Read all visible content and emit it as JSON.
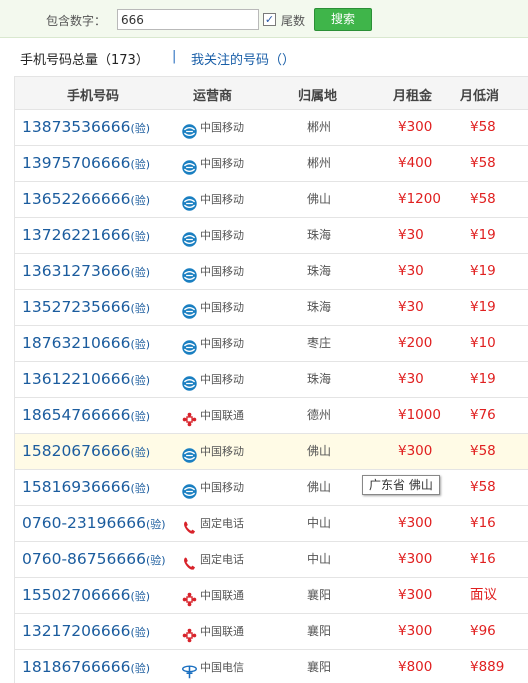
{
  "search": {
    "label": "包含数字：",
    "value": "666",
    "tail_checked": "✓",
    "tail_label": "尾数",
    "button": "搜索"
  },
  "tabs": {
    "total": "手机号码总量（173）",
    "separator": "|",
    "favorites": "我关注的号码（）"
  },
  "table": {
    "headers": {
      "number": "手机号码",
      "operator": "运营商",
      "location": "归属地",
      "rent": "月租金",
      "minimum": "月低消"
    },
    "rows": [
      {
        "number": "13873536666",
        "verify": "(验)",
        "operator": "中国移动",
        "operator_icon": "china-mobile-icon",
        "location": "郴州",
        "rent": "¥300",
        "minimum": "¥58"
      },
      {
        "number": "13975706666",
        "verify": "(验)",
        "operator": "中国移动",
        "operator_icon": "china-mobile-icon",
        "location": "郴州",
        "rent": "¥400",
        "minimum": "¥58"
      },
      {
        "number": "13652266666",
        "verify": "(验)",
        "operator": "中国移动",
        "operator_icon": "china-mobile-icon",
        "location": "佛山",
        "rent": "¥1200",
        "minimum": "¥58"
      },
      {
        "number": "13726221666",
        "verify": "(验)",
        "operator": "中国移动",
        "operator_icon": "china-mobile-icon",
        "location": "珠海",
        "rent": "¥30",
        "minimum": "¥19"
      },
      {
        "number": "13631273666",
        "verify": "(验)",
        "operator": "中国移动",
        "operator_icon": "china-mobile-icon",
        "location": "珠海",
        "rent": "¥30",
        "minimum": "¥19"
      },
      {
        "number": "13527235666",
        "verify": "(验)",
        "operator": "中国移动",
        "operator_icon": "china-mobile-icon",
        "location": "珠海",
        "rent": "¥30",
        "minimum": "¥19"
      },
      {
        "number": "18763210666",
        "verify": "(验)",
        "operator": "中国移动",
        "operator_icon": "china-mobile-icon",
        "location": "枣庄",
        "rent": "¥200",
        "minimum": "¥10"
      },
      {
        "number": "13612210666",
        "verify": "(验)",
        "operator": "中国移动",
        "operator_icon": "china-mobile-icon",
        "location": "珠海",
        "rent": "¥30",
        "minimum": "¥19"
      },
      {
        "number": "18654766666",
        "verify": "(验)",
        "operator": "中国联通",
        "operator_icon": "china-unicom-icon",
        "location": "德州",
        "rent": "¥1000",
        "minimum": "¥76"
      },
      {
        "number": "15820676666",
        "verify": "(验)",
        "operator": "中国移动",
        "operator_icon": "china-mobile-icon",
        "location": "佛山",
        "rent": "¥300",
        "minimum": "¥58",
        "highlight": true
      },
      {
        "number": "15816936666",
        "verify": "(验)",
        "operator": "中国移动",
        "operator_icon": "china-mobile-icon",
        "location": "佛山",
        "rent": "¥300",
        "minimum": "¥58"
      },
      {
        "number": "0760-23196666",
        "verify": "(验)",
        "operator": "固定电话",
        "operator_icon": "landline-phone-icon",
        "location": "中山",
        "rent": "¥300",
        "minimum": "¥16"
      },
      {
        "number": "0760-86756666",
        "verify": "(验)",
        "operator": "固定电话",
        "operator_icon": "landline-phone-icon",
        "location": "中山",
        "rent": "¥300",
        "minimum": "¥16"
      },
      {
        "number": "15502706666",
        "verify": "(验)",
        "operator": "中国联通",
        "operator_icon": "china-unicom-icon",
        "location": "襄阳",
        "rent": "¥300",
        "minimum": "面议"
      },
      {
        "number": "13217206666",
        "verify": "(验)",
        "operator": "中国联通",
        "operator_icon": "china-unicom-icon",
        "location": "襄阳",
        "rent": "¥300",
        "minimum": "¥96"
      },
      {
        "number": "18186766666",
        "verify": "(验)",
        "operator": "中国电信",
        "operator_icon": "china-telecom-icon",
        "location": "襄阳",
        "rent": "¥800",
        "minimum": "¥889"
      }
    ]
  },
  "tooltip": {
    "text": "广东省 佛山"
  },
  "colors": {
    "mobile": "#1a7fc1",
    "unicom": "#d8222a",
    "landline": "#d8222a",
    "telecom": "#1a6fc0",
    "price": "#e02020",
    "search_button": "#3fb54a"
  }
}
